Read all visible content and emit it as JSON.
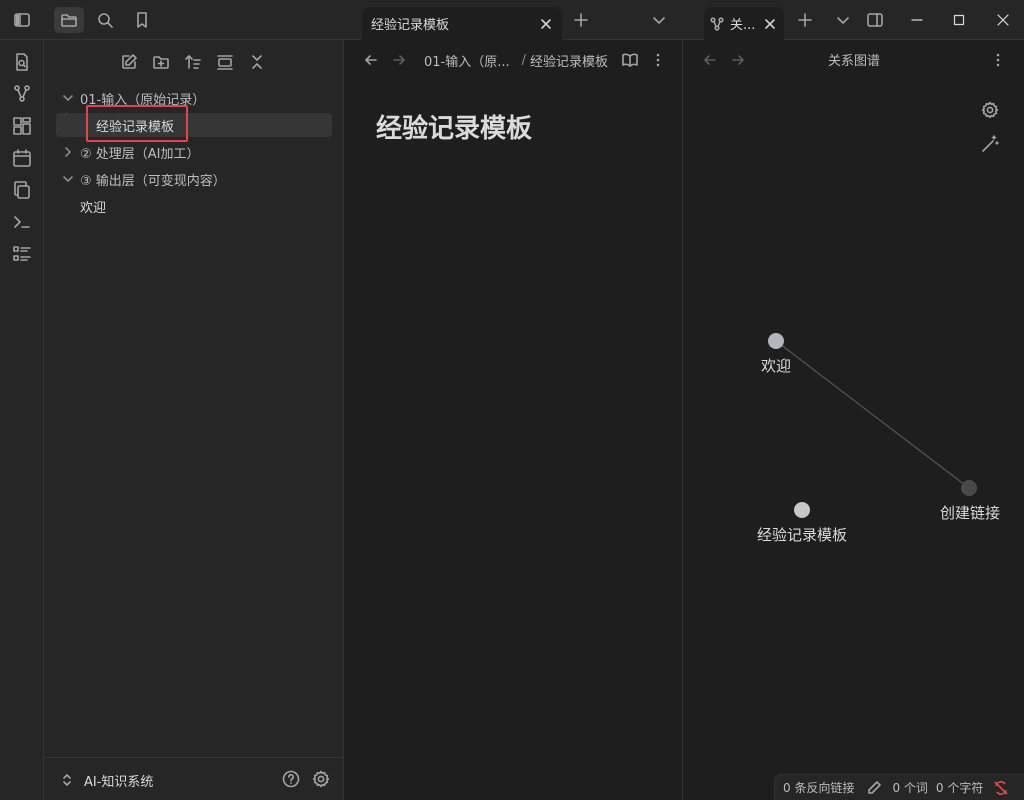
{
  "titlebar": {
    "tab_main": {
      "label": "经验记录模板"
    },
    "tab_graph": {
      "label": "关..."
    }
  },
  "sidebar": {
    "tree": [
      {
        "label": "01-输入（原始记录）",
        "type": "folder",
        "expanded": true
      },
      {
        "label": "经验记录模板",
        "type": "file",
        "selected": true
      },
      {
        "label": "② 处理层（AI加工）",
        "type": "folder",
        "expanded": false
      },
      {
        "label": "③ 输出层（可变现内容）",
        "type": "folder",
        "expanded": true
      },
      {
        "label": "欢迎",
        "type": "file"
      }
    ],
    "vault": {
      "name": "AI-知识系统"
    }
  },
  "editor": {
    "breadcrumb": {
      "folder": "01-输入（原...",
      "separator": "/",
      "file": "经验记录模板"
    },
    "title": "经验记录模板"
  },
  "graph": {
    "title": "关系图谱",
    "nodes": [
      {
        "label": "欢迎"
      },
      {
        "label": "经验记录模板"
      },
      {
        "label": "创建链接"
      }
    ]
  },
  "status": {
    "backlinks": "0 条反向链接",
    "words": "0 个词",
    "chars": "0 个字符"
  },
  "colors": {
    "background": "#1e1e1e",
    "panel": "#262626",
    "highlight_box": "#e0464b",
    "node_active": "#b5b5bd",
    "node_dim": "#4a4a4a",
    "sync_error": "#e04b4b"
  }
}
